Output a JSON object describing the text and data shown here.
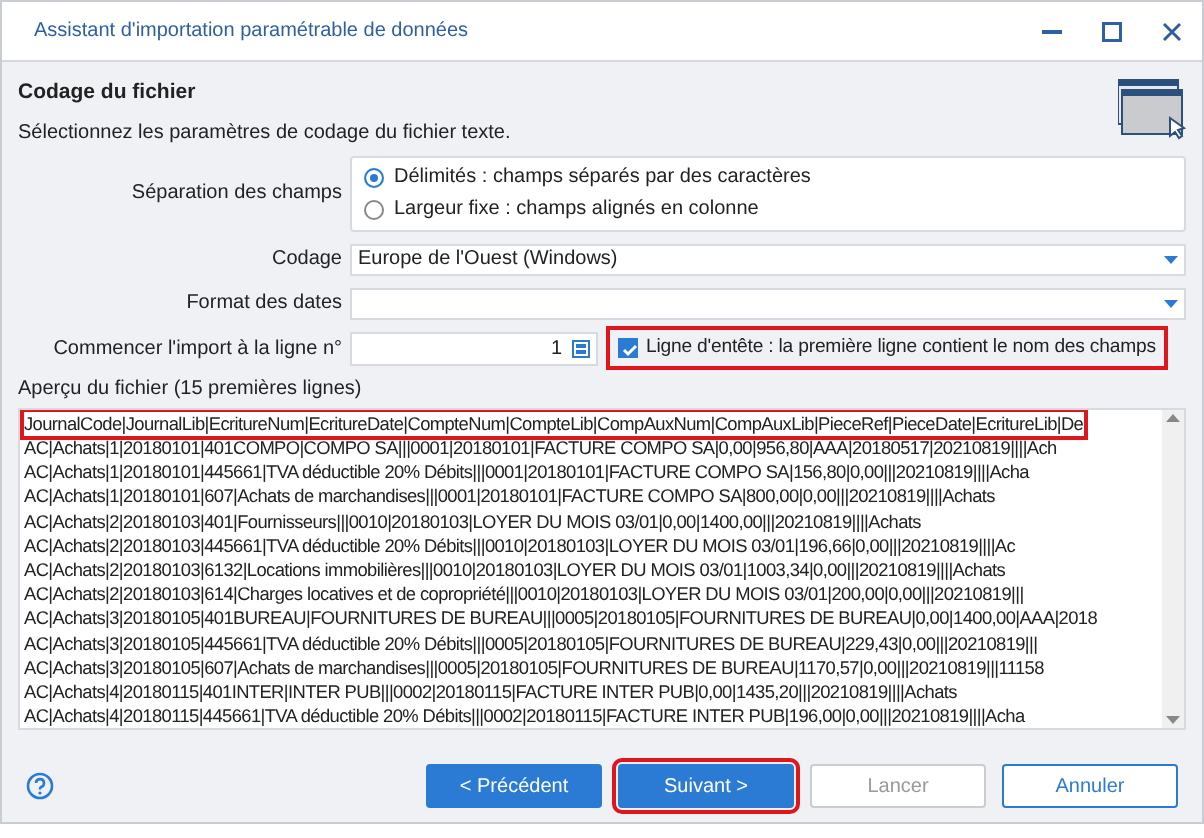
{
  "window": {
    "title": "Assistant d'importation paramétrable de données"
  },
  "header": {
    "title": "Codage du fichier",
    "subtitle": "Sélectionnez les paramètres de codage du fichier texte."
  },
  "separation": {
    "label": "Séparation des champs",
    "options": [
      {
        "label": "Délimités : champs séparés par des caractères",
        "selected": true
      },
      {
        "label": "Largeur fixe : champs alignés en colonne",
        "selected": false
      }
    ]
  },
  "encoding": {
    "label": "Codage",
    "value": "Europe de l'Ouest (Windows)"
  },
  "date_format": {
    "label": "Format des dates"
  },
  "start_line": {
    "label": "Commencer l'import à la ligne n°",
    "value": "1"
  },
  "header_line": {
    "label": "Ligne d'entête : la première ligne contient le nom des champs",
    "checked": true,
    "highlighted": true
  },
  "preview": {
    "label": "Aperçu du fichier (15 premières lignes)",
    "lines": [
      {
        "text": "JournalCode|JournalLib|EcritureNum|EcritureDate|CompteNum|CompteLib|CompAuxNum|CompAuxLib|PieceRef|PieceDate|EcritureLib|De",
        "highlighted": true
      },
      {
        "text": "AC|Achats|1|20180101|401COMPO|COMPO SA|||0001|20180101|FACTURE COMPO SA|0,00|956,80|AAA|20180517|20210819||||Ach",
        "highlighted": false
      },
      {
        "text": "AC|Achats|1|20180101|445661|TVA déductible 20% Débits|||0001|20180101|FACTURE COMPO SA|156,80|0,00|||20210819||||Acha",
        "highlighted": false
      },
      {
        "text": "AC|Achats|1|20180101|607|Achats de marchandises|||0001|20180101|FACTURE COMPO SA|800,00|0,00|||20210819||||Achats",
        "highlighted": false
      },
      {
        "text": "AC|Achats|2|20180103|401|Fournisseurs|||0010|20180103|LOYER DU MOIS 03/01|0,00|1400,00|||20210819||||Achats",
        "highlighted": false
      },
      {
        "text": "AC|Achats|2|20180103|445661|TVA déductible 20% Débits|||0010|20180103|LOYER DU MOIS 03/01|196,66|0,00|||20210819||||Ac",
        "highlighted": false
      },
      {
        "text": "AC|Achats|2|20180103|6132|Locations immobilières|||0010|20180103|LOYER DU MOIS 03/01|1003,34|0,00|||20210819||||Achats",
        "highlighted": false
      },
      {
        "text": "AC|Achats|2|20180103|614|Charges locatives et de copropriété|||0010|20180103|LOYER DU MOIS 03/01|200,00|0,00|||20210819|||",
        "highlighted": false
      },
      {
        "text": "AC|Achats|3|20180105|401BUREAU|FOURNITURES DE BUREAU|||0005|20180105|FOURNITURES DE BUREAU|0,00|1400,00|AAA|2018",
        "highlighted": false
      },
      {
        "text": "AC|Achats|3|20180105|445661|TVA déductible 20% Débits|||0005|20180105|FOURNITURES DE BUREAU|229,43|0,00|||20210819|||",
        "highlighted": false
      },
      {
        "text": "AC|Achats|3|20180105|607|Achats de marchandises|||0005|20180105|FOURNITURES DE BUREAU|1170,57|0,00|||20210819|||11158",
        "highlighted": false
      },
      {
        "text": "AC|Achats|4|20180115|401INTER|INTER PUB|||0002|20180115|FACTURE INTER PUB|0,00|1435,20|||20210819||||Achats",
        "highlighted": false
      },
      {
        "text": "AC|Achats|4|20180115|445661|TVA déductible 20% Débits|||0002|20180115|FACTURE INTER PUB|196,00|0,00|||20210819||||Acha",
        "highlighted": false
      }
    ]
  },
  "buttons": [
    {
      "label": "< Précédent",
      "kind": "primary",
      "disabled": false,
      "highlighted": false
    },
    {
      "label": "Suivant >",
      "kind": "primary",
      "disabled": false,
      "highlighted": true
    },
    {
      "label": "Lancer",
      "kind": "outline",
      "disabled": true,
      "highlighted": false
    },
    {
      "label": "Annuler",
      "kind": "outline",
      "disabled": false,
      "highlighted": false
    }
  ]
}
